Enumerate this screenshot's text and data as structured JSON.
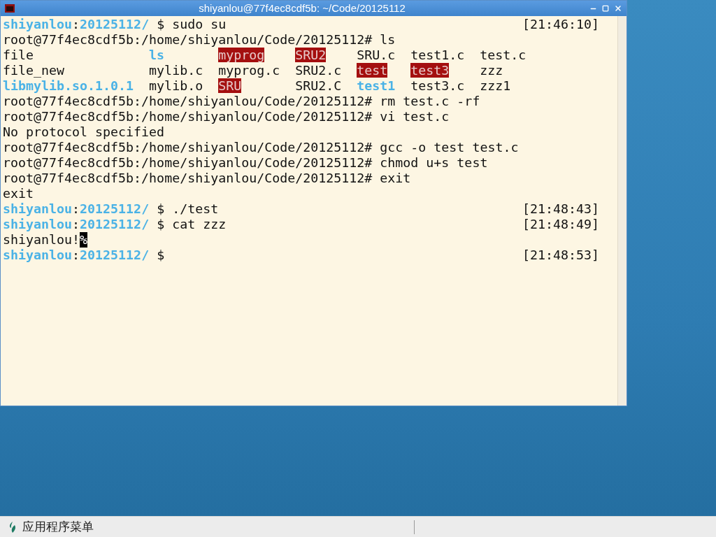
{
  "window": {
    "title": "shiyanlou@77f4ec8cdf5b: ~/Code/20125112"
  },
  "terminal": {
    "lines": [
      {
        "kind": "prompt",
        "user": "shiyanlou",
        "separator": ":",
        "dir": "20125112/",
        "symbol": "$",
        "command": "sudo su",
        "time": "[21:46:10]"
      },
      {
        "kind": "output",
        "text": "root@77f4ec8cdf5b:/home/shiyanlou/Code/20125112# ls"
      },
      {
        "kind": "listing",
        "cells": [
          {
            "text": "file",
            "kind": "plain"
          },
          {
            "text": "ls",
            "kind": "exec"
          },
          {
            "text": "myprog",
            "kind": "setuid"
          },
          {
            "text": "SRU2",
            "kind": "setuid"
          },
          {
            "text": "SRU.c",
            "kind": "plain"
          },
          {
            "text": "test1.c",
            "kind": "plain"
          },
          {
            "text": "test.c",
            "kind": "plain"
          }
        ]
      },
      {
        "kind": "listing",
        "cells": [
          {
            "text": "file_new",
            "kind": "plain"
          },
          {
            "text": "mylib.c",
            "kind": "plain"
          },
          {
            "text": "myprog.c",
            "kind": "plain"
          },
          {
            "text": "SRU2.c",
            "kind": "plain"
          },
          {
            "text": "test",
            "kind": "setuid"
          },
          {
            "text": "test3",
            "kind": "setuid"
          },
          {
            "text": "zzz",
            "kind": "plain"
          }
        ]
      },
      {
        "kind": "listing",
        "cells": [
          {
            "text": "libmylib.so.1.0.1",
            "kind": "exec"
          },
          {
            "text": "mylib.o",
            "kind": "plain"
          },
          {
            "text": "SRU",
            "kind": "setuid"
          },
          {
            "text": "SRU2.C",
            "kind": "plain"
          },
          {
            "text": "test1",
            "kind": "exec"
          },
          {
            "text": "test3.c",
            "kind": "plain"
          },
          {
            "text": "zzz1",
            "kind": "plain"
          }
        ]
      },
      {
        "kind": "output",
        "text": "root@77f4ec8cdf5b:/home/shiyanlou/Code/20125112# rm test.c -rf"
      },
      {
        "kind": "output",
        "text": "root@77f4ec8cdf5b:/home/shiyanlou/Code/20125112# vi test.c"
      },
      {
        "kind": "output",
        "text": "No protocol specified"
      },
      {
        "kind": "output",
        "text": "root@77f4ec8cdf5b:/home/shiyanlou/Code/20125112# gcc -o test test.c"
      },
      {
        "kind": "output",
        "text": "root@77f4ec8cdf5b:/home/shiyanlou/Code/20125112# chmod u+s test"
      },
      {
        "kind": "output",
        "text": "root@77f4ec8cdf5b:/home/shiyanlou/Code/20125112# exit"
      },
      {
        "kind": "output",
        "text": "exit"
      },
      {
        "kind": "prompt",
        "user": "shiyanlou",
        "separator": ":",
        "dir": "20125112/",
        "symbol": "$",
        "command": "./test",
        "time": "[21:48:43]"
      },
      {
        "kind": "prompt",
        "user": "shiyanlou",
        "separator": ":",
        "dir": "20125112/",
        "symbol": "$",
        "command": "cat zzz",
        "time": "[21:48:49]"
      },
      {
        "kind": "output",
        "text": "shiyanlou!",
        "marker": "%"
      },
      {
        "kind": "prompt",
        "user": "shiyanlou",
        "separator": ":",
        "dir": "20125112/",
        "symbol": "$",
        "time": "[21:48:53]"
      }
    ]
  },
  "taskbar": {
    "menu_label": "应用程序菜单"
  }
}
